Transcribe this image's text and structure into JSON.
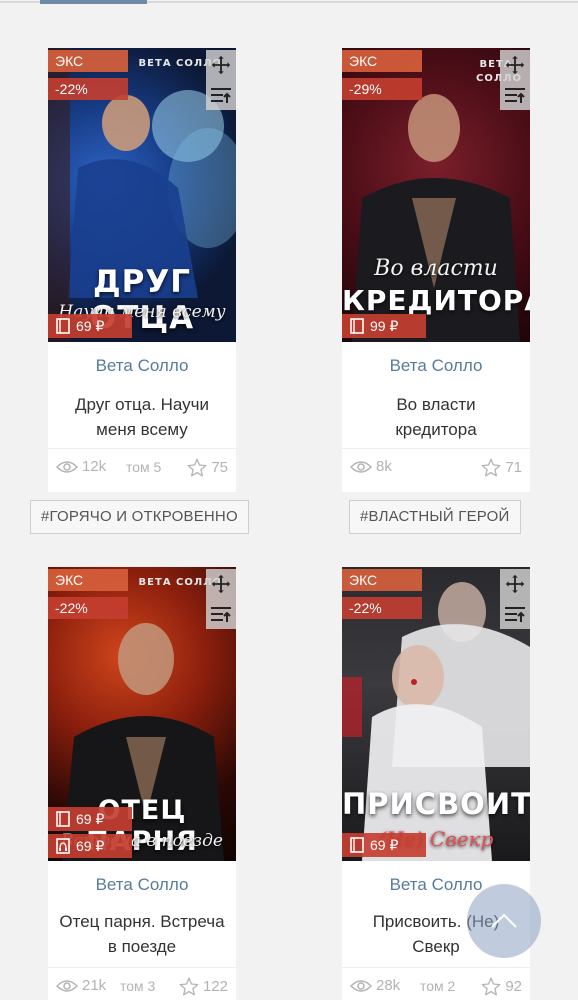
{
  "tab_bar": {
    "active_color": "#6f8aa6"
  },
  "cards": [
    {
      "badge_exclusive": "ЭКС",
      "discount": "-22%",
      "prices": [
        "69 ₽"
      ],
      "cover_title": "ДРУГ ОТЦА",
      "cover_subtitle": "Научи меня всему",
      "cover_author": "ВЕТА СОЛЛО",
      "author": "Вета Солло",
      "title": "Друг отца. Научи меня всему",
      "views": "12k",
      "volume": "том 5",
      "rating": "75"
    },
    {
      "badge_exclusive": "ЭКС",
      "discount": "-29%",
      "prices": [
        "99 ₽"
      ],
      "cover_title": "КРЕДИТОРА",
      "cover_subtitle": "Во власти",
      "cover_author": "ВЕТА СОЛЛО",
      "author": "Вета Солло",
      "title": "Во власти кредитора",
      "views": "8k",
      "volume": "",
      "rating": "71"
    },
    {
      "badge_exclusive": "ЭКС",
      "discount": "-22%",
      "prices": [
        "69 ₽",
        "69 ₽"
      ],
      "cover_title": "ОТЕЦ ПАРНЯ",
      "cover_subtitle": "Встреча в поезде",
      "cover_author": "ВЕТА СОЛЛО",
      "author": "Вета Солло",
      "title": "Отец парня. Встреча в поезде",
      "views": "21k",
      "volume": "том 3",
      "rating": "122"
    },
    {
      "badge_exclusive": "ЭКС",
      "discount": "-22%",
      "prices": [
        "69 ₽"
      ],
      "cover_title": "ПРИСВОИТЬ",
      "cover_subtitle": "(Не) Свекр",
      "cover_author": "Вета Солло",
      "author": "Вета Солло",
      "title": "Присвоить. (Не) Свекр",
      "views": "28k",
      "volume": "том 2",
      "rating": "92"
    }
  ],
  "tags": [
    "#ГОРЯЧО И ОТКРОВЕННО",
    "#ВЛАСТНЫЙ ГЕРОЙ"
  ],
  "icons": {
    "move": "move-arrows-icon",
    "sort": "sort-icon",
    "book": "book-icon",
    "audio": "audiobook-icon",
    "views": "eye-icon",
    "rating": "star-icon",
    "scroll_up": "chevron-up-icon"
  }
}
